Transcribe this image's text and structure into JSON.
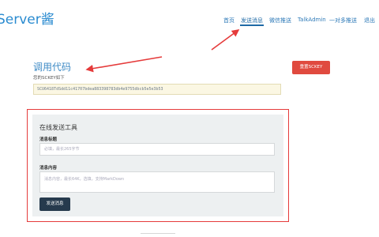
{
  "app": {
    "title": "Server酱"
  },
  "nav": {
    "items": [
      "首页",
      "发送消息",
      "微信推送",
      "TalkAdmin",
      "一对多推送",
      "退出"
    ]
  },
  "key_section": {
    "title": "调用代码",
    "subtitle": "您的SCKEY如下",
    "sckey": "SCU6418TdSdd11c41707bdea883398783db4e9755dbcb5e5e3b53",
    "reset_label": "重置SCKEY"
  },
  "send_tool": {
    "title": "在线发送工具",
    "title_label": "消息标题",
    "title_placeholder": "必填，最长265字节",
    "content_label": "消息内容",
    "content_placeholder": "消息内容，最长64K，选填，支持MarkDown",
    "send_label": "发送消息"
  },
  "colors": {
    "accent": "#2a8bd0",
    "danger": "#e04a3f",
    "annotation": "#e53b3b",
    "dark_button": "#263a4d"
  }
}
